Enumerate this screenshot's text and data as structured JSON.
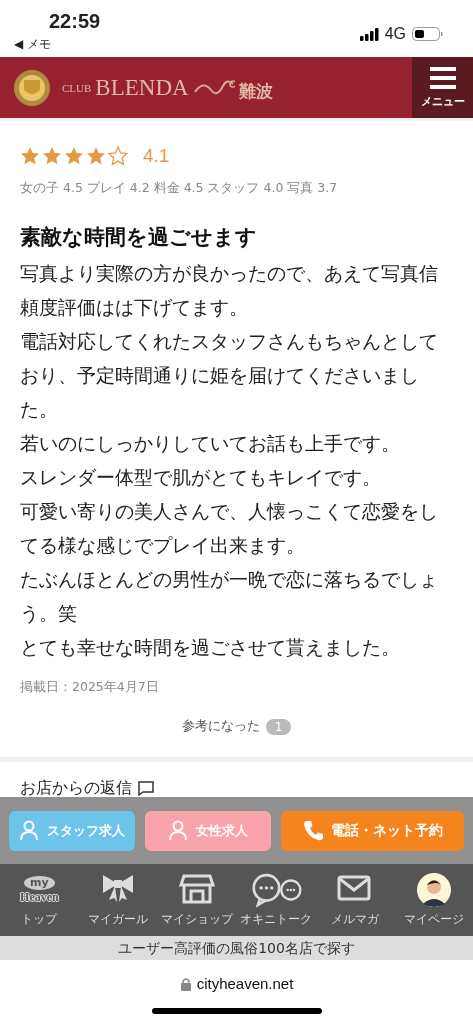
{
  "status_bar": {
    "time": "22:59",
    "back_label": "◀ メモ",
    "network": "4G"
  },
  "header": {
    "logo_prefix": "CLUB",
    "logo_name": "BLENDA",
    "logo_area": "難波",
    "menu_label": "メニュー"
  },
  "review": {
    "stars": 4,
    "score": "4.1",
    "sub_ratings": "女の子 4.5 プレイ 4.2 料金 4.5 スタッフ 4.0 写真 3.7",
    "title": "素敵な時間を過ごせます",
    "body": [
      "写真より実際の方が良かったので、あえて写真信頼度評価はは下げてます。",
      "電話対応してくれたスタッフさんもちゃんとしており、予定時間通りに姫を届けてくださいました。",
      "若いのにしっかりしていてお話も上手です。",
      "スレンダー体型で肌がとてもキレイです。",
      "可愛い寄りの美人さんで、人懐っこくて恋愛をしてる様な感じでプレイ出来ます。",
      "たぶんほとんどの男性が一晩で恋に落ちるでしょう。笑",
      "とても幸せな時間を過ごさせて貰えました。"
    ],
    "posted": "掲載日：2025年4月7日",
    "helpful_label": "参考になった",
    "helpful_count": "1"
  },
  "reply": {
    "heading": "お店からの返信"
  },
  "action_buttons": [
    {
      "kind": "staff",
      "label": "スタッフ求人"
    },
    {
      "kind": "female",
      "label": "女性求人"
    },
    {
      "kind": "phone",
      "label": "電話・ネット予約"
    }
  ],
  "nav": [
    {
      "kind": "top",
      "label": "トップ",
      "badge_top": "my",
      "badge_bottom": "Heaven"
    },
    {
      "kind": "bow",
      "label": "マイガール"
    },
    {
      "kind": "shop",
      "label": "マイショップ"
    },
    {
      "kind": "talk",
      "label": "オキニトーク"
    },
    {
      "kind": "mail",
      "label": "メルマガ"
    },
    {
      "kind": "avatar",
      "label": "マイページ"
    }
  ],
  "banner": "ユーザー高評価の風俗100名店で探す",
  "browser": {
    "url": "cityheaven.net"
  }
}
